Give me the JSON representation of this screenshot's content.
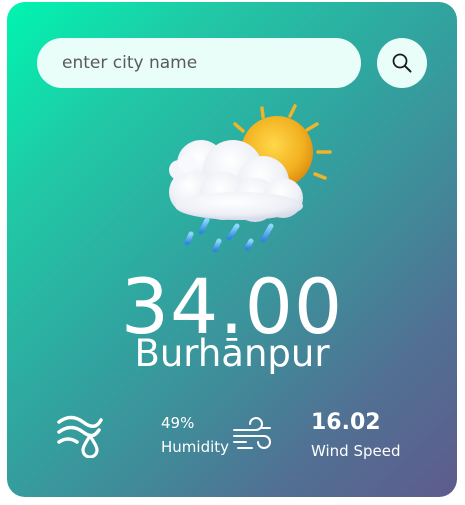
{
  "search": {
    "placeholder": "enter city name",
    "button_icon": "search-icon"
  },
  "weather": {
    "icon": "sun-cloud-rain-icon",
    "temperature": "34.00",
    "city": "Burhānpur"
  },
  "humidity": {
    "icon": "humidity-icon",
    "value": "49%",
    "label": "Humidity"
  },
  "wind": {
    "icon": "wind-icon",
    "value": "16.02",
    "label": "Wind Speed"
  },
  "colors": {
    "gradient_start": "#00f5b0",
    "gradient_end": "#5e5b8c",
    "input_background": "#e9fef8",
    "text": "#ffffff"
  }
}
